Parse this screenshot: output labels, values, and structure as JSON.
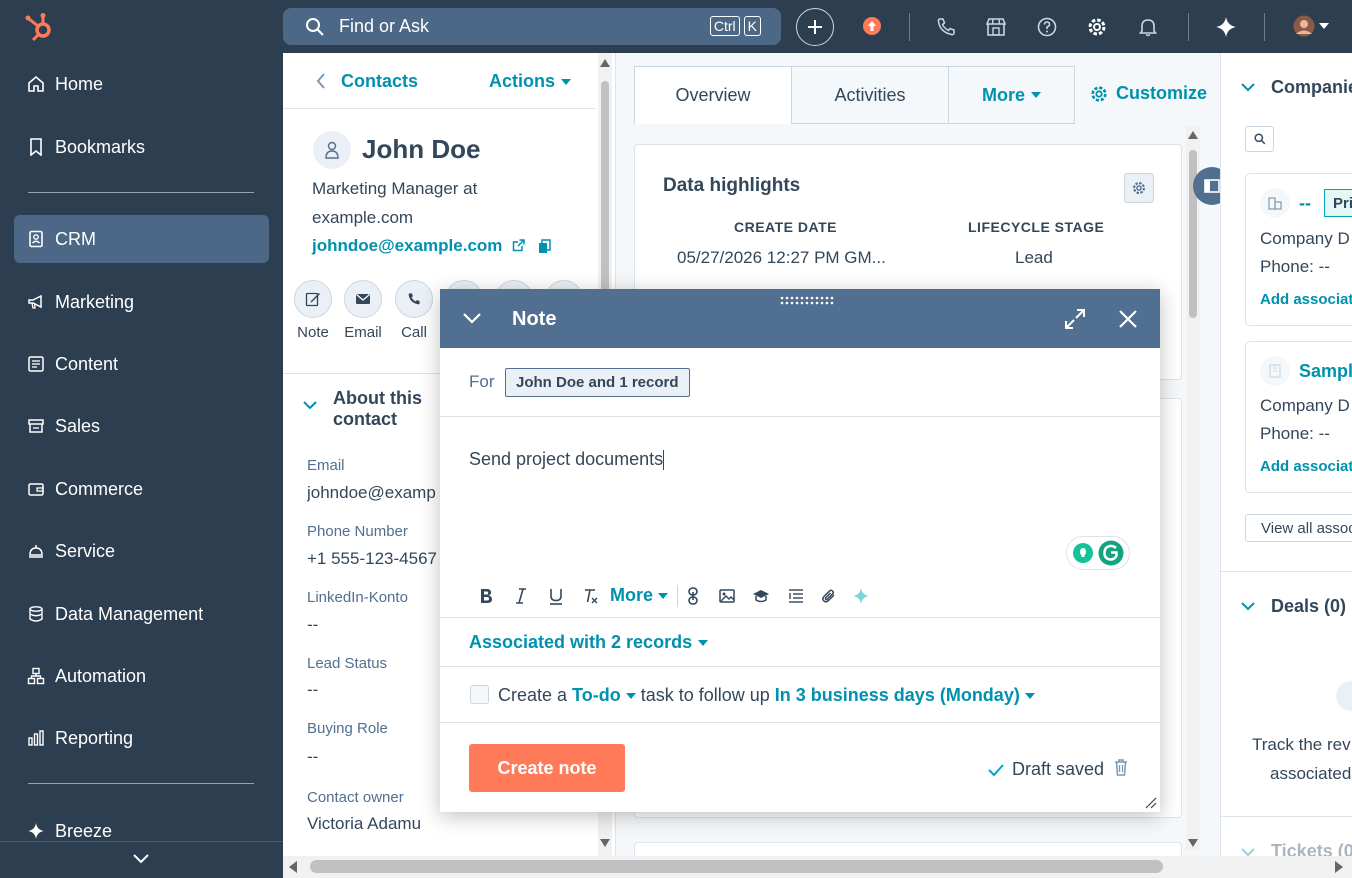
{
  "sidebar": {
    "items": [
      {
        "label": "Home",
        "icon": "home-icon"
      },
      {
        "label": "Bookmarks",
        "icon": "bookmark-icon"
      },
      {
        "label": "CRM",
        "icon": "crm-icon",
        "active": true
      },
      {
        "label": "Marketing",
        "icon": "megaphone-icon"
      },
      {
        "label": "Content",
        "icon": "content-icon"
      },
      {
        "label": "Sales",
        "icon": "sales-icon"
      },
      {
        "label": "Commerce",
        "icon": "wallet-icon"
      },
      {
        "label": "Service",
        "icon": "service-icon"
      },
      {
        "label": "Data Management",
        "icon": "database-icon"
      },
      {
        "label": "Automation",
        "icon": "automation-icon"
      },
      {
        "label": "Reporting",
        "icon": "reporting-icon"
      },
      {
        "label": "Breeze",
        "icon": "sparkle-icon"
      }
    ]
  },
  "topbar": {
    "search_placeholder": "Find or Ask",
    "shortcut_ctrl": "Ctrl",
    "shortcut_k": "K"
  },
  "contact": {
    "back_label": "Contacts",
    "actions_label": "Actions",
    "name": "John Doe",
    "title_line1": "Marketing Manager at",
    "title_line2": "example.com",
    "email": "johndoe@example.com",
    "actions": [
      {
        "label": "Note",
        "icon": "note-icon"
      },
      {
        "label": "Email",
        "icon": "email-icon"
      },
      {
        "label": "Call",
        "icon": "call-icon"
      }
    ],
    "about_heading_1": "About this",
    "about_heading_2": "contact",
    "properties": [
      {
        "label": "Email",
        "value": "johndoe@examp"
      },
      {
        "label": "Phone Number",
        "value": "+1 555-123-4567"
      },
      {
        "label": "LinkedIn-Konto",
        "value": "--"
      },
      {
        "label": "Lead Status",
        "value": "--"
      },
      {
        "label": "Buying Role",
        "value": "--"
      },
      {
        "label": "Contact owner",
        "value": "Victoria Adamu"
      }
    ]
  },
  "middle": {
    "tabs": [
      "Overview",
      "Activities",
      "More"
    ],
    "customize_label": "Customize",
    "highlights_title": "Data highlights",
    "create_date_label": "CREATE DATE",
    "create_date_value": "05/27/2026 12:27 PM GM...",
    "lifecycle_label": "LIFECYCLE STAGE",
    "lifecycle_value": "Lead"
  },
  "right": {
    "companies_title": "Companie",
    "company1_name": "--",
    "company1_badge": "Pri",
    "company_domain_label": "Company D",
    "phone_label": "Phone: --",
    "add_assoc_1": "Add associatio",
    "company2_name": "Sample",
    "add_assoc_2": "Add associatio",
    "view_all": "View all assoc",
    "deals_title": "Deals (0)",
    "deals_text_1": "Track the rev",
    "deals_text_2": "associated",
    "tickets_title": "Tickets (0"
  },
  "note": {
    "title": "Note",
    "for_label": "For",
    "for_record": "John Doe and 1 record",
    "body": "Send project documents",
    "toolbar_more": "More",
    "associated": "Associated with 2 records",
    "task_prefix": "Create a",
    "task_type": "To-do",
    "task_middle": "task to follow up",
    "task_due": "In 3 business days (Monday)",
    "create_button": "Create note",
    "draft_status": "Draft saved"
  }
}
